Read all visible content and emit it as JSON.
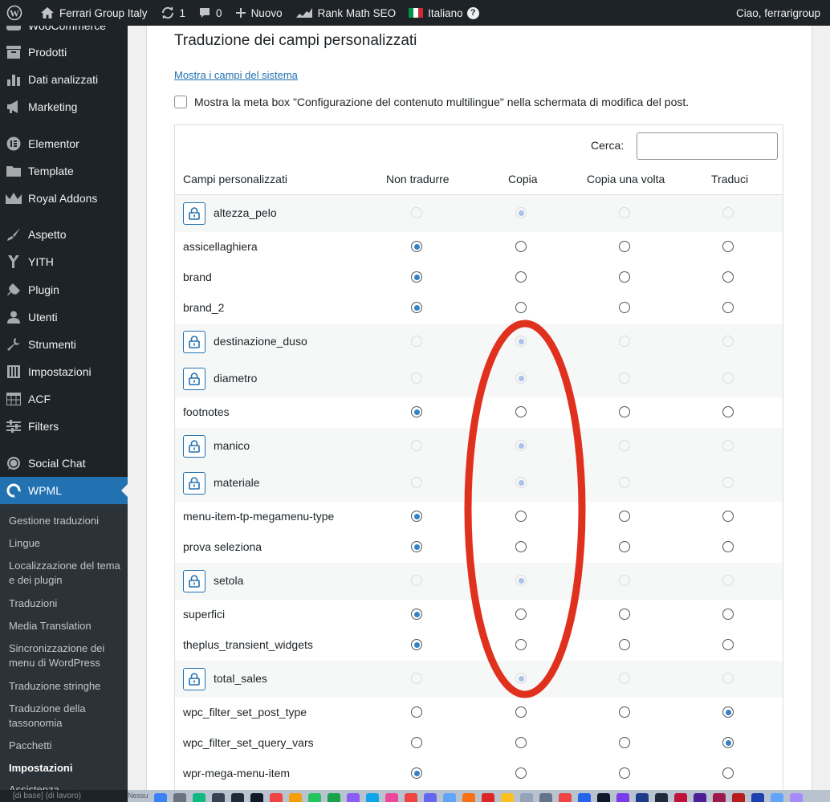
{
  "adminbar": {
    "site_name": "Ferrari Group Italy",
    "updates_count": "1",
    "comments_count": "0",
    "new_label": "Nuovo",
    "seo_label": "Rank Math SEO",
    "language_label": "Italiano",
    "greeting": "Ciao, ferrarigroup"
  },
  "sidebar": {
    "items": [
      {
        "label": "WooCommerce",
        "icon": "woocommerce-icon"
      },
      {
        "label": "Prodotti",
        "icon": "archive-icon"
      },
      {
        "label": "Dati analizzati",
        "icon": "bar-chart-icon"
      },
      {
        "label": "Marketing",
        "icon": "megaphone-icon"
      },
      {
        "label": "Elementor",
        "icon": "elementor-icon"
      },
      {
        "label": "Template",
        "icon": "folder-icon"
      },
      {
        "label": "Royal Addons",
        "icon": "crown-icon"
      },
      {
        "label": "Aspetto",
        "icon": "paintbrush-icon"
      },
      {
        "label": "YITH",
        "icon": "yith-icon"
      },
      {
        "label": "Plugin",
        "icon": "plug-icon"
      },
      {
        "label": "Utenti",
        "icon": "user-icon"
      },
      {
        "label": "Strumenti",
        "icon": "wrench-icon"
      },
      {
        "label": "Impostazioni",
        "icon": "settings-icon"
      },
      {
        "label": "ACF",
        "icon": "table-icon"
      },
      {
        "label": "Filters",
        "icon": "filter-sliders-icon"
      },
      {
        "label": "Social Chat",
        "icon": "whatsapp-icon"
      },
      {
        "label": "WPML",
        "icon": "wpml-icon"
      }
    ],
    "submenu": [
      {
        "label": "Gestione traduzioni"
      },
      {
        "label": "Lingue"
      },
      {
        "label": "Localizzazione del tema e dei plugin"
      },
      {
        "label": "Traduzioni"
      },
      {
        "label": "Media Translation"
      },
      {
        "label": "Sincronizzazione dei menu di WordPress"
      },
      {
        "label": "Traduzione stringhe"
      },
      {
        "label": "Traduzione della tassonomia"
      },
      {
        "label": "Pacchetti"
      },
      {
        "label": "Impostazioni"
      },
      {
        "label": "Assistenza"
      }
    ]
  },
  "main": {
    "heading": "Traduzione dei campi personalizzati",
    "system_fields_link": "Mostra i campi del sistema",
    "metabox_checkbox_label": "Mostra la meta box \"Configurazione del contenuto multilingue\" nella schermata di modifica del post.",
    "metabox_checked": false,
    "search_label": "Cerca:",
    "search_value": "",
    "columns": [
      "Campi personalizzati",
      "Non tradurre",
      "Copia",
      "Copia una volta",
      "Traduci"
    ],
    "rows": [
      {
        "name": "altezza_pelo",
        "locked": true,
        "selected": "Copia"
      },
      {
        "name": "assicellaghiera",
        "locked": false,
        "selected": "Non tradurre"
      },
      {
        "name": "brand",
        "locked": false,
        "selected": "Non tradurre"
      },
      {
        "name": "brand_2",
        "locked": false,
        "selected": "Non tradurre"
      },
      {
        "name": "destinazione_duso",
        "locked": true,
        "selected": "Copia"
      },
      {
        "name": "diametro",
        "locked": true,
        "selected": "Copia"
      },
      {
        "name": "footnotes",
        "locked": false,
        "selected": "Non tradurre"
      },
      {
        "name": "manico",
        "locked": true,
        "selected": "Copia"
      },
      {
        "name": "materiale",
        "locked": true,
        "selected": "Copia"
      },
      {
        "name": "menu-item-tp-megamenu-type",
        "locked": false,
        "selected": "Non tradurre"
      },
      {
        "name": "prova seleziona",
        "locked": false,
        "selected": "Non tradurre"
      },
      {
        "name": "setola",
        "locked": true,
        "selected": "Copia"
      },
      {
        "name": "superfici",
        "locked": false,
        "selected": "Non tradurre"
      },
      {
        "name": "theplus_transient_widgets",
        "locked": false,
        "selected": "Non tradurre"
      },
      {
        "name": "total_sales",
        "locked": true,
        "selected": "Copia"
      },
      {
        "name": "wpc_filter_set_post_type",
        "locked": false,
        "selected": "Traduci"
      },
      {
        "name": "wpc_filter_set_query_vars",
        "locked": false,
        "selected": "Traduci"
      },
      {
        "name": "wpr-mega-menu-item",
        "locked": false,
        "selected": "Non tradurre"
      }
    ]
  },
  "annotation": {
    "color": "#e0301e"
  },
  "dock": {
    "left_text": "[di base] (di lavoro)",
    "middle_text": "Nessu"
  },
  "colors": {
    "accent": "#2271b1",
    "admin_dark": "#1d2327",
    "radio_checked": "#3582c4"
  }
}
